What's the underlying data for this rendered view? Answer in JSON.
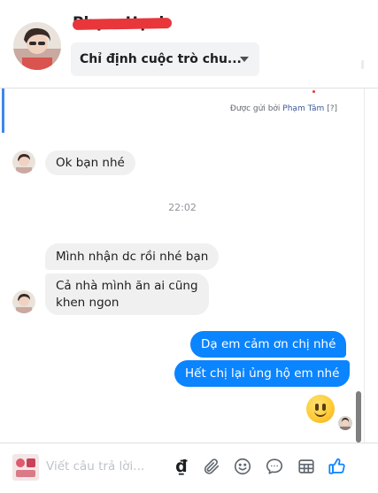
{
  "header": {
    "contact_name": "Phạm Hạnh",
    "assign_label": "Chỉ định cuộc trò chu..."
  },
  "thread": {
    "sent_by_prefix": "Được gửi bởi",
    "sent_by_name": "Phạm Tâm",
    "sent_by_help": "[?]",
    "timestamp": "22:02",
    "messages": [
      {
        "direction": "in",
        "text": "Ok bạn nhé"
      },
      {
        "direction": "in",
        "text": "Mình nhận dc rồi nhé bạn"
      },
      {
        "direction": "in",
        "lines": [
          "Cả nhà mình ăn ai cũng",
          "khen ngon"
        ]
      },
      {
        "direction": "out",
        "text": "Dạ em cảm ơn chị nhé"
      },
      {
        "direction": "out",
        "text": "Hết chị lại ủng hộ em nhé"
      }
    ]
  },
  "composer": {
    "placeholder": "Viết câu trả lời...",
    "currency_symbol": "₫"
  },
  "colors": {
    "outgoing_bubble": "#0b84ff",
    "incoming_bubble": "#f1f0f0",
    "accent_link": "#385898"
  },
  "icons": [
    "chevron-down-icon",
    "attachment-icon",
    "emoji-icon",
    "quick-reply-icon",
    "saved-replies-icon",
    "like-icon"
  ]
}
